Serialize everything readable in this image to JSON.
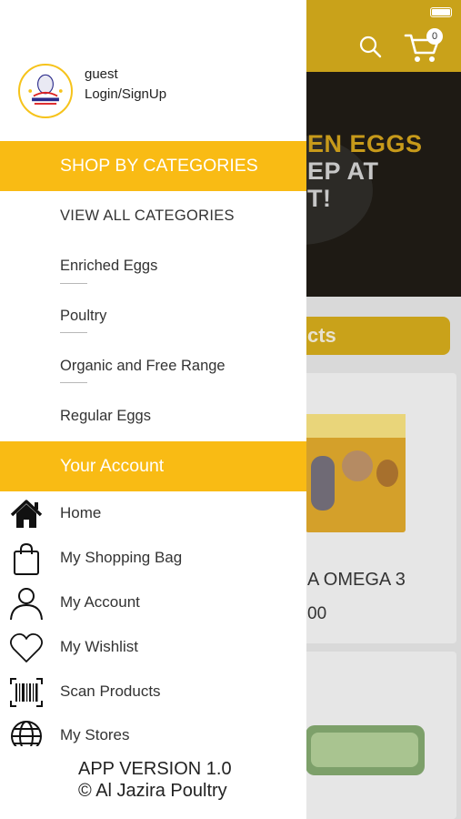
{
  "background": {
    "cart_count": "0",
    "banner_lines": [
      "EN EGGS",
      "EP AT",
      "T!"
    ],
    "section_pill": "cts",
    "product": {
      "title": "A OMEGA 3",
      "price": "00"
    }
  },
  "drawer": {
    "user": {
      "name": "guest",
      "login_label": "Login/SignUp"
    },
    "categories_header": "SHOP BY CATEGORIES",
    "view_all": "VIEW ALL CATEGORIES",
    "categories": [
      "Enriched Eggs",
      "Poultry",
      "Organic and Free Range",
      "Regular Eggs"
    ],
    "account_header": "Your Account",
    "account_items": [
      {
        "label": "Home",
        "icon": "home-icon"
      },
      {
        "label": "My Shopping Bag",
        "icon": "shopping-bag-icon"
      },
      {
        "label": "My Account",
        "icon": "user-icon"
      },
      {
        "label": "My Wishlist",
        "icon": "heart-icon"
      },
      {
        "label": "Scan Products",
        "icon": "barcode-icon"
      },
      {
        "label": "My Stores",
        "icon": "globe-icon"
      }
    ],
    "version": "APP VERSION  1.0",
    "copyright": "© Al Jazira Poultry"
  },
  "colors": {
    "accent": "#f9bb14",
    "overlay_accent": "#c9a21a"
  }
}
